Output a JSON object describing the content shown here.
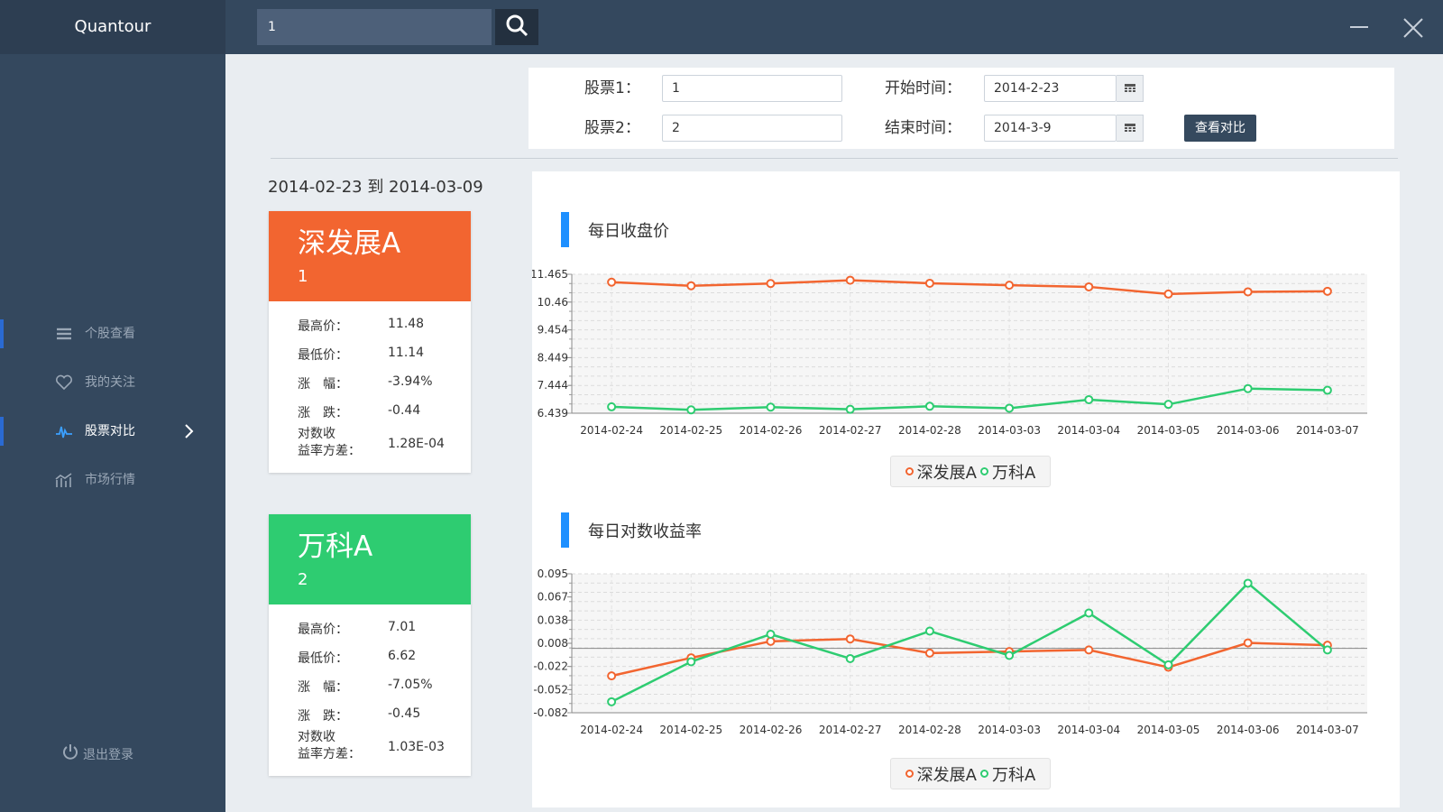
{
  "app": {
    "title": "Quantour"
  },
  "search": {
    "value": "1"
  },
  "sidebar": {
    "items": [
      {
        "label": "个股查看",
        "icon": "list-icon",
        "active": false
      },
      {
        "label": "我的关注",
        "icon": "heart-icon",
        "active": false
      },
      {
        "label": "股票对比",
        "icon": "compare-icon",
        "active": true
      },
      {
        "label": "市场行情",
        "icon": "market-chart-icon",
        "active": false
      }
    ],
    "logout_label": "退出登录"
  },
  "form": {
    "stock1_label": "股票1：",
    "stock1_value": "1",
    "stock2_label": "股票2：",
    "stock2_value": "2",
    "start_label": "开始时间：",
    "start_value": "2014-2-23",
    "end_label": "结束时间：",
    "end_value": "2014-3-9",
    "compare_button": "查看对比"
  },
  "date_range": "2014-02-23 到 2014-03-09",
  "stocks": [
    {
      "name": "深发展A",
      "code": "1",
      "color": "#f26530",
      "high_label": "最高价：",
      "high": "11.48",
      "low_label": "最低价：",
      "low": "11.14",
      "change_pct_label": "涨　幅：",
      "change_pct": "-3.94%",
      "change_label": "涨　跌：",
      "change": "-0.44",
      "variance_label_1": "对数收",
      "variance_label_2": "益率方差：",
      "variance": "1.28E-04"
    },
    {
      "name": "万科A",
      "code": "2",
      "color": "#2ecc71",
      "high_label": "最高价：",
      "high": "7.01",
      "low_label": "最低价：",
      "low": "6.62",
      "change_pct_label": "涨　幅：",
      "change_pct": "-7.05%",
      "change_label": "涨　跌：",
      "change": "-0.45",
      "variance_label_1": "对数收",
      "variance_label_2": "益率方差：",
      "variance": "1.03E-03"
    }
  ],
  "chart_data": [
    {
      "type": "line",
      "title": "每日收盘价",
      "categories": [
        "2014-02-24",
        "2014-02-25",
        "2014-02-26",
        "2014-02-27",
        "2014-02-28",
        "2014-03-03",
        "2014-03-04",
        "2014-03-05",
        "2014-03-06",
        "2014-03-07"
      ],
      "yticks": [
        "11.465",
        "10.46",
        "9.454",
        "8.449",
        "7.444",
        "6.439"
      ],
      "ylim": [
        6.439,
        11.465
      ],
      "grid": true,
      "legend_position": "bottom",
      "series": [
        {
          "name": "深发展A",
          "color": "#f26530",
          "values": [
            11.18,
            11.05,
            11.13,
            11.25,
            11.14,
            11.07,
            11.01,
            10.75,
            10.83,
            10.85
          ]
        },
        {
          "name": "万科A",
          "color": "#2ecc71",
          "values": [
            6.67,
            6.56,
            6.66,
            6.58,
            6.69,
            6.62,
            6.93,
            6.76,
            7.33,
            7.27
          ]
        }
      ]
    },
    {
      "type": "line",
      "title": "每日对数收益率",
      "categories": [
        "2014-02-24",
        "2014-02-25",
        "2014-02-26",
        "2014-02-27",
        "2014-02-28",
        "2014-03-03",
        "2014-03-04",
        "2014-03-05",
        "2014-03-06",
        "2014-03-07"
      ],
      "yticks": [
        "0.095",
        "0.067",
        "0.038",
        "0.008",
        "-0.022",
        "-0.052",
        "-0.082"
      ],
      "ylim": [
        -0.082,
        0.095
      ],
      "grid": true,
      "legend_position": "bottom",
      "series": [
        {
          "name": "深发展A",
          "color": "#f26530",
          "values": [
            -0.035,
            -0.012,
            0.009,
            0.012,
            -0.006,
            -0.004,
            -0.002,
            -0.024,
            0.007,
            0.004
          ]
        },
        {
          "name": "万科A",
          "color": "#2ecc71",
          "values": [
            -0.068,
            -0.017,
            0.018,
            -0.013,
            0.022,
            -0.009,
            0.045,
            -0.021,
            0.083,
            -0.002
          ]
        }
      ]
    }
  ]
}
